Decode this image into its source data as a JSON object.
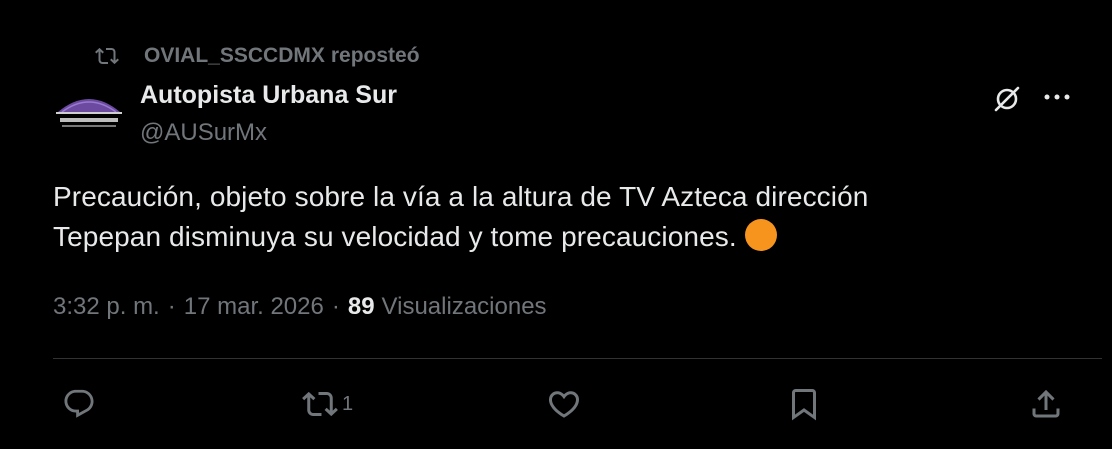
{
  "repost": {
    "reposter": "OVIAL_SSCCDMX",
    "label": "reposteó",
    "icon": "repost-icon"
  },
  "author": {
    "name": "Autopista Urbana Sur",
    "handle": "@AUSurMx",
    "avatar_alt": "Autopista Urbana Sur logo"
  },
  "tweet": {
    "line1": "Precaución, objeto sobre la vía a la altura de TV Azteca dirección",
    "line2": "Tepepan disminuya su velocidad y tome precauciones.",
    "emoji": "orange-circle"
  },
  "meta": {
    "time": "3:32 p. m.",
    "separator": "·",
    "date": "17 mar. 2026",
    "views_count": "89",
    "views_label": "Visualizaciones"
  },
  "actions": {
    "reply_count": "",
    "repost_count": "1",
    "like_count": "",
    "icons": [
      "reply-icon",
      "repost-icon",
      "like-icon",
      "bookmark-icon",
      "share-icon"
    ]
  },
  "colors": {
    "background": "#000000",
    "primary_text": "#e7e9ea",
    "secondary_text": "#71767b",
    "divider": "#2f3336",
    "emoji_orange": "#f7941d"
  }
}
